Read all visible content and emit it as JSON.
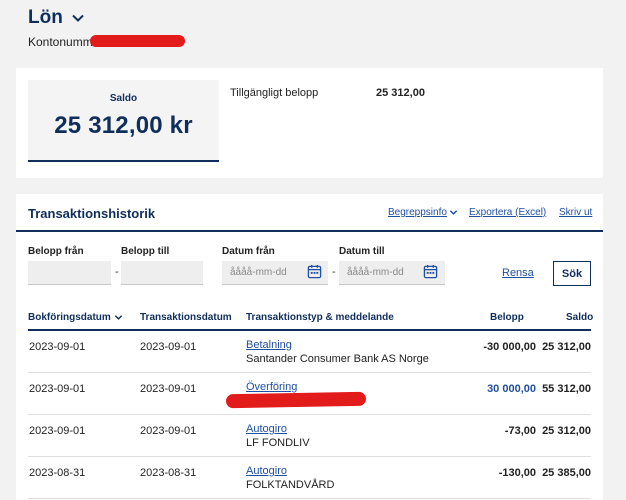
{
  "account": {
    "title": "Lön",
    "number_label": "Kontonummer"
  },
  "balance": {
    "saldo_label": "Saldo",
    "saldo_value": "25 312,00 kr",
    "available_label": "Tillgängligt belopp",
    "available_value": "25 312,00"
  },
  "transactions": {
    "title": "Transaktionshistorik",
    "links": {
      "begrepp": "Begreppsinfo",
      "exportera": "Exportera (Excel)",
      "skriv": "Skriv ut"
    },
    "filters": {
      "belopp_fran_label": "Belopp från",
      "belopp_till_label": "Belopp till",
      "datum_fran_label": "Datum från",
      "datum_till_label": "Datum till",
      "date_placeholder": "åååå-mm-dd",
      "rensa": "Rensa",
      "sok": "Sök"
    },
    "columns": {
      "bokforingsdatum": "Bokföringsdatum",
      "transaktionsdatum": "Transaktionsdatum",
      "typ": "Transaktionstyp & meddelande",
      "belopp": "Belopp",
      "saldo": "Saldo"
    },
    "rows": [
      {
        "bok": "2023-09-01",
        "tra": "2023-09-01",
        "typ": "Betalning",
        "msg": "Santander Consumer Bank AS Norge",
        "belopp": "-30 000,00",
        "saldo": "25 312,00"
      },
      {
        "bok": "2023-09-01",
        "tra": "2023-09-01",
        "typ": "Överföring",
        "msg": "",
        "belopp": "30 000,00",
        "saldo": "55 312,00"
      },
      {
        "bok": "2023-09-01",
        "tra": "2023-09-01",
        "typ": "Autogiro",
        "msg": "LF FONDLIV",
        "belopp": "-73,00",
        "saldo": "25 312,00"
      },
      {
        "bok": "2023-08-31",
        "tra": "2023-08-31",
        "typ": "Autogiro",
        "msg": "FOLKTANDVÅRD",
        "belopp": "-130,00",
        "saldo": "25 385,00"
      }
    ]
  },
  "colors": {
    "navy": "#0f2e5c",
    "link": "#1f4fa0",
    "redaction": "#e21b1b"
  }
}
